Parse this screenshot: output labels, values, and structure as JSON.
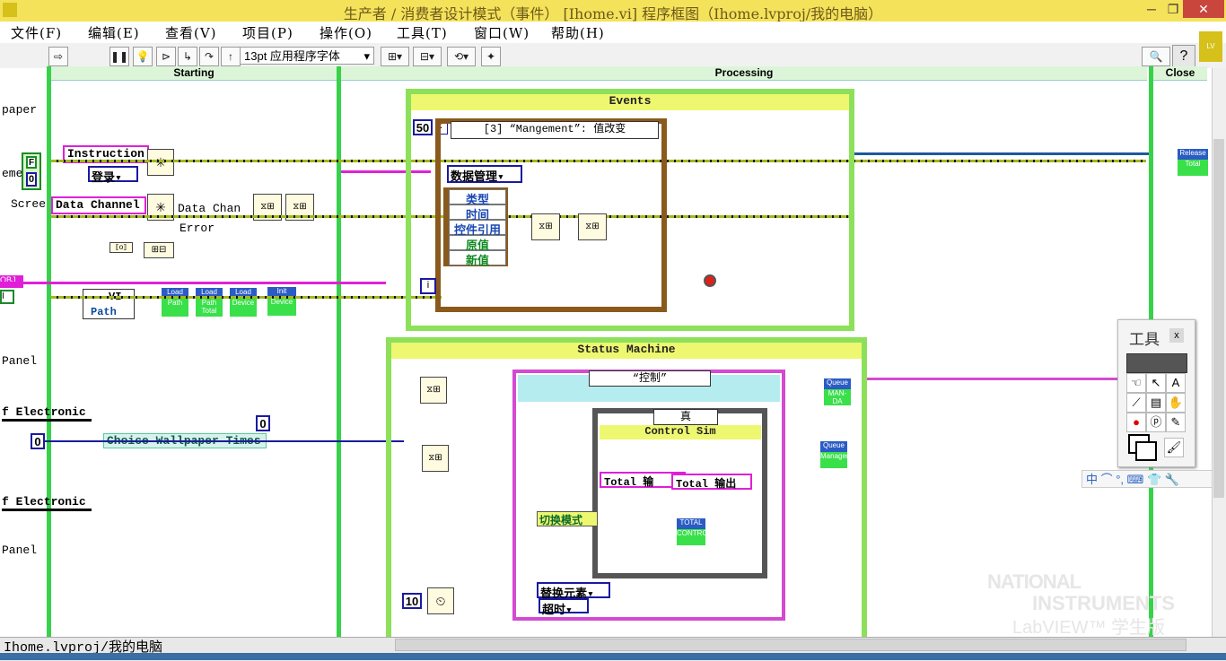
{
  "window": {
    "title": "生产者 / 消费者设计模式（事件） [Ihome.vi] 程序框图（Ihome.lvproj/我的电脑）",
    "buttons": {
      "minimize": "─",
      "restore": "❐",
      "close": "✕"
    }
  },
  "menu": [
    "文件(F)",
    "编辑(E)",
    "查看(V)",
    "项目(P)",
    "操作(O)",
    "工具(T)",
    "窗口(W)",
    "帮助(H)"
  ],
  "toolbar": {
    "font": "13pt 应用程序字体",
    "buttons": [
      "run-arrow",
      "pause",
      "highlight-bulb",
      "retain-wire",
      "step-into",
      "step-over",
      "step-out",
      "align",
      "distribute",
      "reorder",
      "cleanup"
    ]
  },
  "columns": {
    "starting": "Starting",
    "processing": "Processing",
    "close": "Close"
  },
  "left": {
    "labels": [
      "paper",
      "eme",
      "Scree",
      "Panel",
      "f Electronic",
      "f Electronic",
      "Panel"
    ],
    "instruction": "Instruction",
    "login": "登录",
    "data_channel": "Data Channel",
    "data_chan_short": "Data Chan",
    "error": "Error",
    "vi_ref": "VI",
    "path": "Path",
    "obj": "OBJ",
    "choice": "Choice Wallpaper Times",
    "zero1": "0",
    "zero2": "0",
    "zero3": "0",
    "f_const": "F",
    "tags": [
      "Load",
      "Path",
      "Load",
      "Path Total",
      "Load",
      "Device",
      "Init",
      "Device"
    ]
  },
  "events": {
    "title": "Events",
    "timeout": "50",
    "selector": "[3] “Mangement”: 值改变",
    "cluster": "数据管理",
    "fields": [
      "类型",
      "时间",
      "控件引用",
      "原值",
      "新值"
    ],
    "iteration": "i"
  },
  "status": {
    "title": "Status Machine",
    "case_selector": "“控制”",
    "inner_case": "真",
    "inner_label": "Control Sim",
    "total_out1": "Total 输",
    "total_out2": "Total 输出",
    "total_tag": "TOTAL",
    "control_tag": "CONTROL",
    "switch_mode": "切换模式",
    "replace": "替换元素",
    "timeout": "超时",
    "wait_ms": "10",
    "queue_tags": [
      "Queue",
      "MAN-DA",
      "Queue",
      "Manager"
    ]
  },
  "close": {
    "release": "Release",
    "total": "Total"
  },
  "tools": {
    "title": "工具",
    "close": "x"
  },
  "ime": "中 ⌒ °, ⌨ 👕 🔧",
  "statusbar": {
    "project": "Ihome.lvproj/我的电脑"
  },
  "watermark": {
    "line1": "NATIONAL",
    "line2": "INSTRUMENTS",
    "line3": "LabVIEW™ 学生版"
  },
  "colors": {
    "title_bg": "#f5e25b",
    "struct_green": "#8de05a",
    "header_yellow": "#eef770",
    "case_brown": "#8a5a1c",
    "wire_pink": "#e020d8",
    "wire_blue": "#1a1aa0"
  }
}
